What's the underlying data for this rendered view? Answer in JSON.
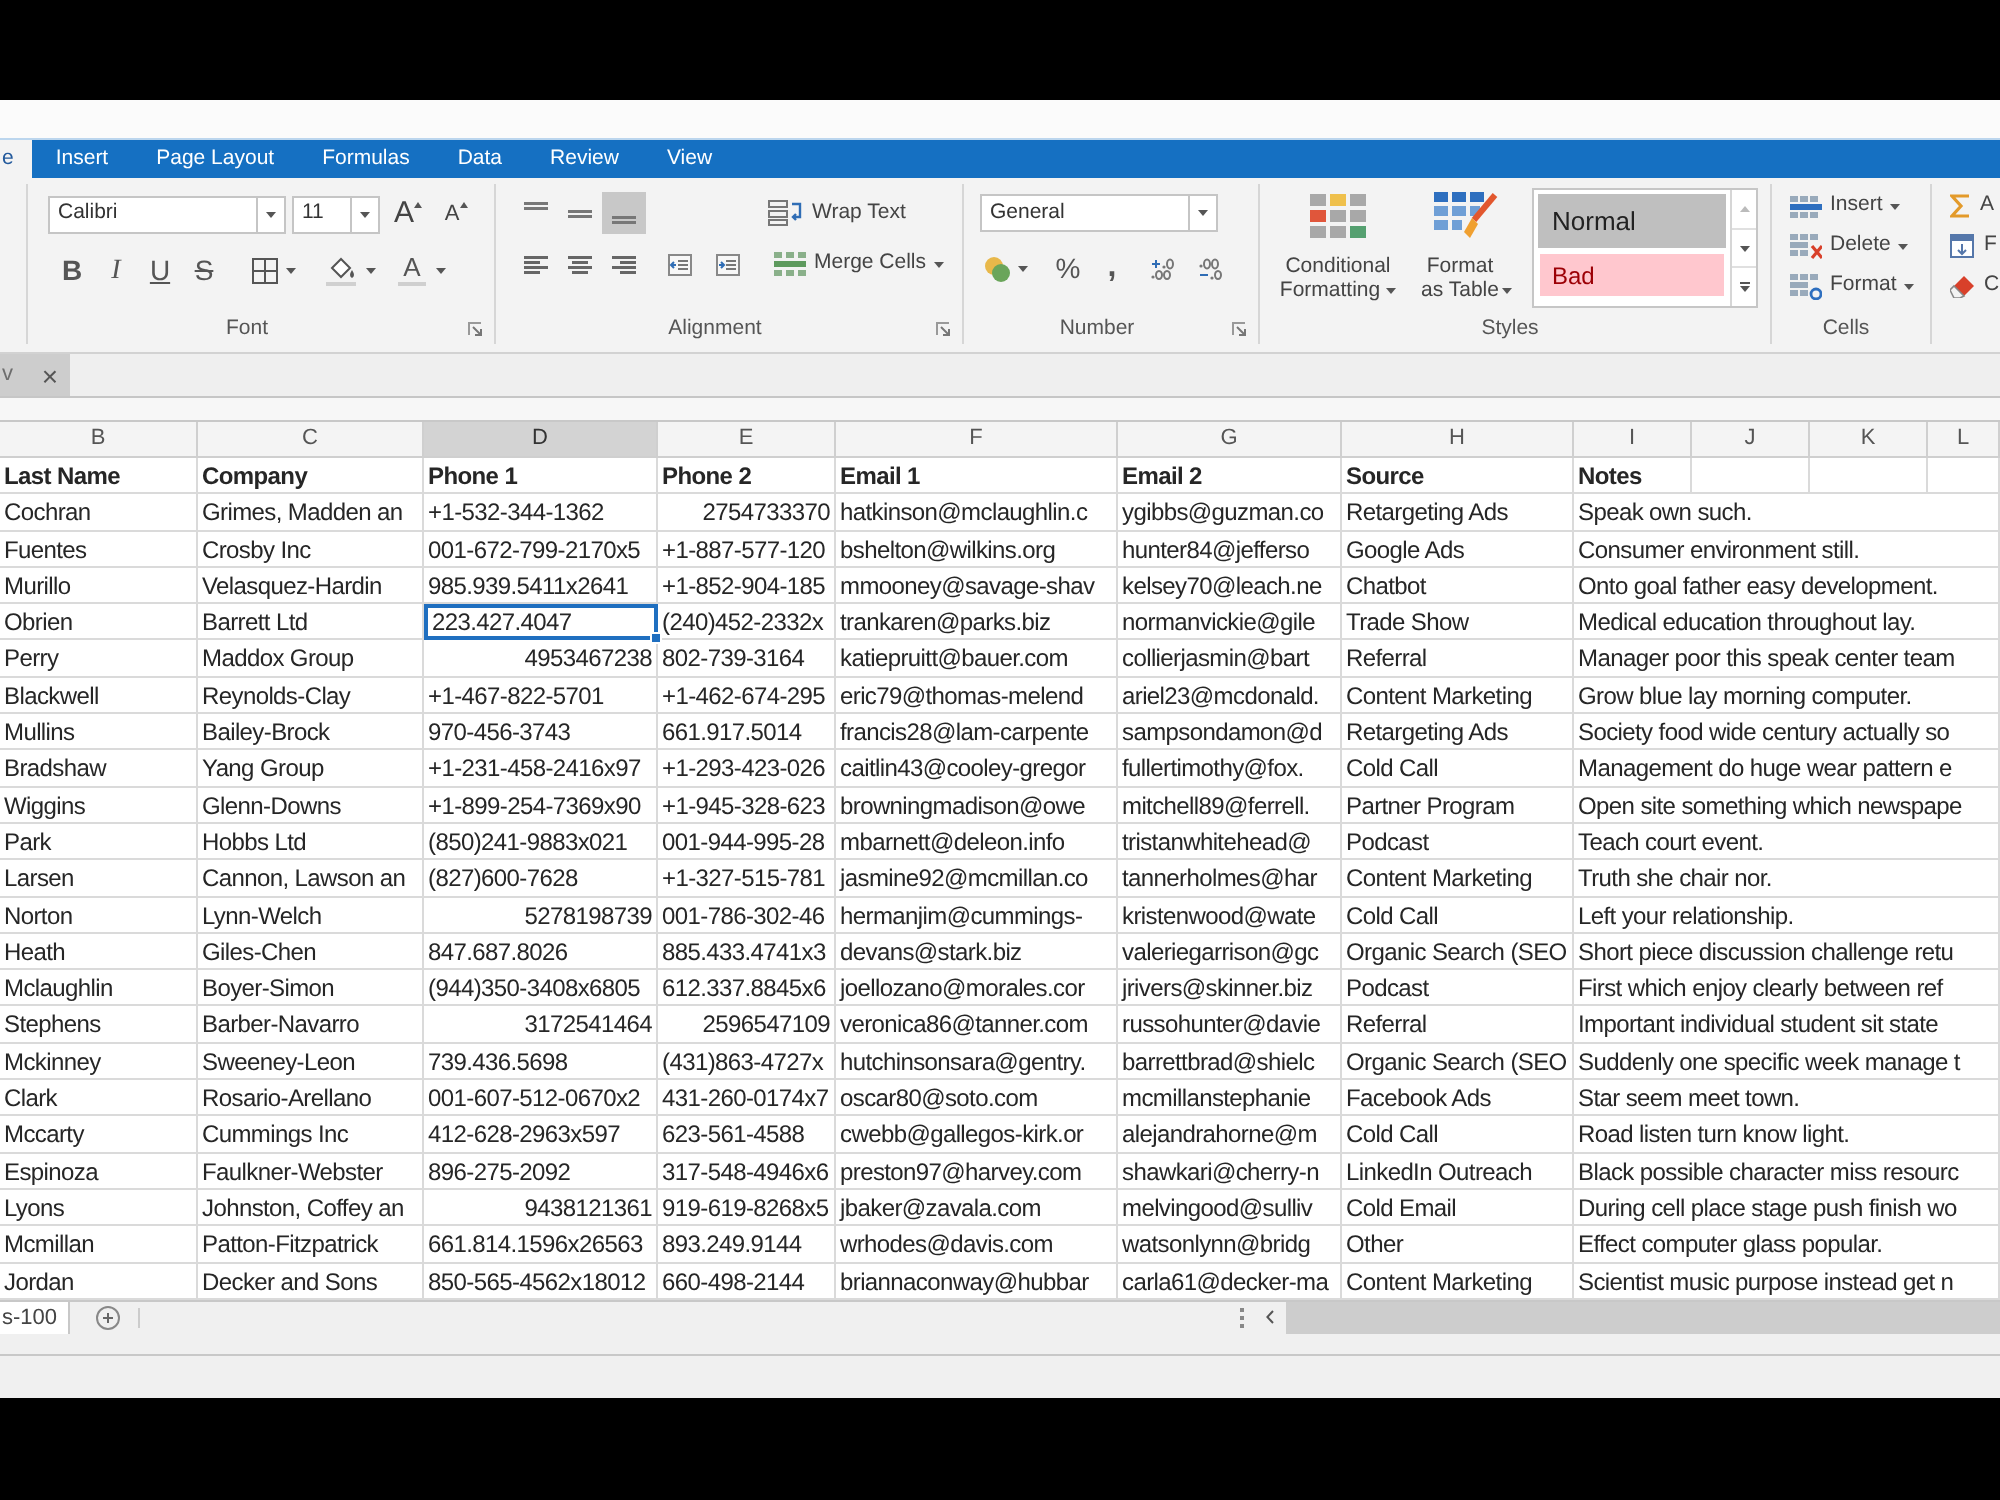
{
  "ribbon_tabs": [
    {
      "label": "e",
      "selected": true
    },
    {
      "label": "Insert",
      "selected": false
    },
    {
      "label": "Page Layout",
      "selected": false
    },
    {
      "label": "Formulas",
      "selected": false
    },
    {
      "label": "Data",
      "selected": false
    },
    {
      "label": "Review",
      "selected": false
    },
    {
      "label": "View",
      "selected": false
    }
  ],
  "ribbon": {
    "font": {
      "name": "Calibri",
      "size": "11",
      "resize_buttons": [
        {
          "kind": "grow",
          "label": "A"
        },
        {
          "kind": "shrink",
          "label": "A"
        }
      ],
      "style_buttons": [
        {
          "kind": "bold",
          "label": "B"
        },
        {
          "kind": "italic",
          "label": "I"
        },
        {
          "kind": "underline",
          "label": "U"
        },
        {
          "kind": "strikethrough",
          "label": "S"
        }
      ],
      "font_color_label": "A",
      "title": "Font"
    },
    "alignment": {
      "vertical": [
        {
          "kind": "top",
          "selected": false
        },
        {
          "kind": "middle",
          "selected": false
        },
        {
          "kind": "bottom",
          "selected": true
        }
      ],
      "wrap_text": "Wrap Text",
      "merge_cells": "Merge Cells",
      "title": "Alignment"
    },
    "number": {
      "format": "General",
      "percent": "%",
      "comma": ",",
      "title": "Number"
    },
    "styles": {
      "conditional_formatting": "Conditional Formatting",
      "format_as_table": "Format as Table",
      "gallery": [
        {
          "kind": "normal",
          "label": "Normal"
        },
        {
          "kind": "bad",
          "label": "Bad"
        }
      ],
      "title": "Styles"
    },
    "cells": {
      "buttons": [
        {
          "kind": "insert",
          "label": "Insert"
        },
        {
          "kind": "delete",
          "label": "Delete"
        },
        {
          "kind": "format",
          "label": "Format"
        }
      ],
      "title": "Cells"
    },
    "editing": {
      "buttons": [
        {
          "kind": "sigma",
          "label": "A"
        },
        {
          "kind": "fill",
          "label": "F"
        },
        {
          "kind": "eraser",
          "label": "C"
        }
      ]
    }
  },
  "document_tab": {
    "title": "v",
    "close": "×"
  },
  "sheet": {
    "columns": [
      {
        "letter": "B",
        "selected": false
      },
      {
        "letter": "C",
        "selected": false
      },
      {
        "letter": "D",
        "selected": true
      },
      {
        "letter": "E",
        "selected": false
      },
      {
        "letter": "F",
        "selected": false
      },
      {
        "letter": "G",
        "selected": false
      },
      {
        "letter": "H",
        "selected": false
      },
      {
        "letter": "I",
        "selected": false
      },
      {
        "letter": "J",
        "selected": false
      },
      {
        "letter": "K",
        "selected": false
      },
      {
        "letter": "L",
        "selected": false
      }
    ],
    "header": [
      "Last Name",
      "Company",
      "Phone 1",
      "Phone 2",
      "Email 1",
      "Email 2",
      "Source",
      "Notes"
    ],
    "rows": [
      {
        "last_name": "Cochran",
        "company": "Grimes, Madden an",
        "phone_1": {
          "text": "+1-532-344-1362",
          "kind": "text",
          "selected": false
        },
        "phone_2": {
          "text": "2754733370",
          "kind": "number",
          "selected": false
        },
        "email_1": "hatkinson@mclaughlin.c",
        "email_2": "ygibbs@guzman.co",
        "source": "Retargeting Ads",
        "notes": "Speak own such."
      },
      {
        "last_name": "Fuentes",
        "company": "Crosby Inc",
        "phone_1": {
          "text": "001-672-799-2170x5",
          "kind": "text",
          "selected": false
        },
        "phone_2": {
          "text": "+1-887-577-120",
          "kind": "text",
          "selected": false
        },
        "email_1": "bshelton@wilkins.org",
        "email_2": "hunter84@jefferso",
        "source": "Google Ads",
        "notes": "Consumer environment still."
      },
      {
        "last_name": "Murillo",
        "company": "Velasquez-Hardin",
        "phone_1": {
          "text": "985.939.5411x2641",
          "kind": "text",
          "selected": false
        },
        "phone_2": {
          "text": "+1-852-904-185",
          "kind": "text",
          "selected": false
        },
        "email_1": "mmooney@savage-shav",
        "email_2": "kelsey70@leach.ne",
        "source": "Chatbot",
        "notes": "Onto goal father easy development."
      },
      {
        "last_name": "Obrien",
        "company": "Barrett Ltd",
        "phone_1": {
          "text": "223.427.4047",
          "kind": "text",
          "selected": true
        },
        "phone_2": {
          "text": "(240)452-2332x",
          "kind": "text",
          "selected": false
        },
        "email_1": "trankaren@parks.biz",
        "email_2": "normanvickie@gile",
        "source": "Trade Show",
        "notes": "Medical education throughout lay."
      },
      {
        "last_name": "Perry",
        "company": "Maddox Group",
        "phone_1": {
          "text": "4953467238",
          "kind": "number",
          "selected": false
        },
        "phone_2": {
          "text": "802-739-3164",
          "kind": "text",
          "selected": false
        },
        "email_1": "katiepruitt@bauer.com",
        "email_2": "collierjasmin@bart",
        "source": "Referral",
        "notes": "Manager poor this speak center team"
      },
      {
        "last_name": "Blackwell",
        "company": "Reynolds-Clay",
        "phone_1": {
          "text": "+1-467-822-5701",
          "kind": "text",
          "selected": false
        },
        "phone_2": {
          "text": "+1-462-674-295",
          "kind": "text",
          "selected": false
        },
        "email_1": "eric79@thomas-melend",
        "email_2": "ariel23@mcdonald.",
        "source": "Content Marketing",
        "notes": "Grow blue lay morning computer."
      },
      {
        "last_name": "Mullins",
        "company": "Bailey-Brock",
        "phone_1": {
          "text": "970-456-3743",
          "kind": "text",
          "selected": false
        },
        "phone_2": {
          "text": "661.917.5014",
          "kind": "text",
          "selected": false
        },
        "email_1": "francis28@lam-carpente",
        "email_2": "sampsondamon@d",
        "source": "Retargeting Ads",
        "notes": "Society food wide century actually so"
      },
      {
        "last_name": "Bradshaw",
        "company": "Yang Group",
        "phone_1": {
          "text": "+1-231-458-2416x97",
          "kind": "text",
          "selected": false
        },
        "phone_2": {
          "text": "+1-293-423-026",
          "kind": "text",
          "selected": false
        },
        "email_1": "caitlin43@cooley-gregor",
        "email_2": "fullertimothy@fox.",
        "source": "Cold Call",
        "notes": "Management do huge wear pattern e"
      },
      {
        "last_name": "Wiggins",
        "company": "Glenn-Downs",
        "phone_1": {
          "text": "+1-899-254-7369x90",
          "kind": "text",
          "selected": false
        },
        "phone_2": {
          "text": "+1-945-328-623",
          "kind": "text",
          "selected": false
        },
        "email_1": "browningmadison@owe",
        "email_2": "mitchell89@ferrell.",
        "source": "Partner Program",
        "notes": "Open site something which newspape"
      },
      {
        "last_name": "Park",
        "company": "Hobbs Ltd",
        "phone_1": {
          "text": "(850)241-9883x021",
          "kind": "text",
          "selected": false
        },
        "phone_2": {
          "text": "001-944-995-28",
          "kind": "text",
          "selected": false
        },
        "email_1": "mbarnett@deleon.info",
        "email_2": "tristanwhitehead@",
        "source": "Podcast",
        "notes": "Teach court event."
      },
      {
        "last_name": "Larsen",
        "company": "Cannon, Lawson an",
        "phone_1": {
          "text": "(827)600-7628",
          "kind": "text",
          "selected": false
        },
        "phone_2": {
          "text": "+1-327-515-781",
          "kind": "text",
          "selected": false
        },
        "email_1": "jasmine92@mcmillan.co",
        "email_2": "tannerholmes@har",
        "source": "Content Marketing",
        "notes": "Truth she chair nor."
      },
      {
        "last_name": "Norton",
        "company": "Lynn-Welch",
        "phone_1": {
          "text": "5278198739",
          "kind": "number",
          "selected": false
        },
        "phone_2": {
          "text": "001-786-302-46",
          "kind": "text",
          "selected": false
        },
        "email_1": "hermanjim@cummings-",
        "email_2": "kristenwood@wate",
        "source": "Cold Call",
        "notes": "Left your relationship."
      },
      {
        "last_name": "Heath",
        "company": "Giles-Chen",
        "phone_1": {
          "text": "847.687.8026",
          "kind": "text",
          "selected": false
        },
        "phone_2": {
          "text": "885.433.4741x3",
          "kind": "text",
          "selected": false
        },
        "email_1": "devans@stark.biz",
        "email_2": "valeriegarrison@gc",
        "source": "Organic Search (SEO",
        "notes": "Short piece discussion challenge retu"
      },
      {
        "last_name": "Mclaughlin",
        "company": "Boyer-Simon",
        "phone_1": {
          "text": "(944)350-3408x6805",
          "kind": "text",
          "selected": false
        },
        "phone_2": {
          "text": "612.337.8845x6",
          "kind": "text",
          "selected": false
        },
        "email_1": "joellozano@morales.cor",
        "email_2": "jrivers@skinner.biz",
        "source": "Podcast",
        "notes": "First which enjoy clearly between ref"
      },
      {
        "last_name": "Stephens",
        "company": "Barber-Navarro",
        "phone_1": {
          "text": "3172541464",
          "kind": "number",
          "selected": false
        },
        "phone_2": {
          "text": "2596547109",
          "kind": "number",
          "selected": false
        },
        "email_1": "veronica86@tanner.com",
        "email_2": "russohunter@davie",
        "source": "Referral",
        "notes": "Important individual student sit state"
      },
      {
        "last_name": "Mckinney",
        "company": "Sweeney-Leon",
        "phone_1": {
          "text": "739.436.5698",
          "kind": "text",
          "selected": false
        },
        "phone_2": {
          "text": "(431)863-4727x",
          "kind": "text",
          "selected": false
        },
        "email_1": "hutchinsonsara@gentry.",
        "email_2": "barrettbrad@shielc",
        "source": "Organic Search (SEO",
        "notes": "Suddenly one specific week manage t"
      },
      {
        "last_name": "Clark",
        "company": "Rosario-Arellano",
        "phone_1": {
          "text": "001-607-512-0670x2",
          "kind": "text",
          "selected": false
        },
        "phone_2": {
          "text": "431-260-0174x7",
          "kind": "text",
          "selected": false
        },
        "email_1": "oscar80@soto.com",
        "email_2": "mcmillanstephanie",
        "source": "Facebook Ads",
        "notes": "Star seem meet town."
      },
      {
        "last_name": "Mccarty",
        "company": "Cummings Inc",
        "phone_1": {
          "text": "412-628-2963x597",
          "kind": "text",
          "selected": false
        },
        "phone_2": {
          "text": "623-561-4588",
          "kind": "text",
          "selected": false
        },
        "email_1": "cwebb@gallegos-kirk.or",
        "email_2": "alejandrahorne@m",
        "source": "Cold Call",
        "notes": "Road listen turn know light."
      },
      {
        "last_name": "Espinoza",
        "company": "Faulkner-Webster",
        "phone_1": {
          "text": "896-275-2092",
          "kind": "text",
          "selected": false
        },
        "phone_2": {
          "text": "317-548-4946x6",
          "kind": "text",
          "selected": false
        },
        "email_1": "preston97@harvey.com",
        "email_2": "shawkari@cherry-n",
        "source": "LinkedIn Outreach",
        "notes": "Black possible character miss resourc"
      },
      {
        "last_name": "Lyons",
        "company": "Johnston, Coffey an",
        "phone_1": {
          "text": "9438121361",
          "kind": "number",
          "selected": false
        },
        "phone_2": {
          "text": "919-619-8268x5",
          "kind": "text",
          "selected": false
        },
        "email_1": "jbaker@zavala.com",
        "email_2": "melvingood@sulliv",
        "source": "Cold Email",
        "notes": "During cell place stage push finish wo"
      },
      {
        "last_name": "Mcmillan",
        "company": "Patton-Fitzpatrick",
        "phone_1": {
          "text": "661.814.1596x26563",
          "kind": "text",
          "selected": false
        },
        "phone_2": {
          "text": "893.249.9144",
          "kind": "text",
          "selected": false
        },
        "email_1": "wrhodes@davis.com",
        "email_2": "watsonlynn@bridg",
        "source": "Other",
        "notes": "Effect computer glass popular."
      },
      {
        "last_name": "Jordan",
        "company": "Decker and Sons",
        "phone_1": {
          "text": "850-565-4562x18012",
          "kind": "text",
          "selected": false
        },
        "phone_2": {
          "text": "660-498-2144",
          "kind": "text",
          "selected": false
        },
        "email_1": "briannaconway@hubbar",
        "email_2": "carla61@decker-ma",
        "source": "Content Marketing",
        "notes": "Scientist music purpose instead get n"
      }
    ]
  },
  "sheet_tabs": [
    {
      "label": "s-100",
      "selected": true
    }
  ]
}
